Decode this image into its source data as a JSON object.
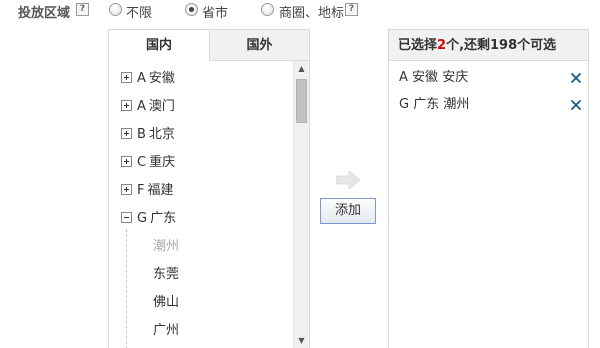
{
  "region": {
    "label": "投放区域",
    "help": "?",
    "options": [
      {
        "label": "不限",
        "checked": false
      },
      {
        "label": "省市",
        "checked": true
      },
      {
        "label": "商圈、地标",
        "checked": false
      }
    ]
  },
  "tabs": [
    "国内",
    "国外"
  ],
  "tree": {
    "provinces": [
      {
        "letter": "A",
        "name": "安徽",
        "expanded": false
      },
      {
        "letter": "A",
        "name": "澳门",
        "expanded": false
      },
      {
        "letter": "B",
        "name": "北京",
        "expanded": false
      },
      {
        "letter": "C",
        "name": "重庆",
        "expanded": false
      },
      {
        "letter": "F",
        "name": "福建",
        "expanded": false
      },
      {
        "letter": "G",
        "name": "广东",
        "expanded": true
      }
    ],
    "children": [
      {
        "name": "潮州",
        "selected": true
      },
      {
        "name": "东莞",
        "selected": false
      },
      {
        "name": "佛山",
        "selected": false
      },
      {
        "name": "广州",
        "selected": false
      }
    ]
  },
  "add_button": "添加",
  "selected_panel": {
    "prefix": "已选择",
    "count": "2",
    "suffix": "个,还剩198个可选",
    "items": [
      {
        "letter": "A",
        "province": "安徽",
        "city": "安庆"
      },
      {
        "letter": "G",
        "province": "广东",
        "city": "潮州"
      }
    ]
  },
  "colors": {
    "accent_count": "#dd0000",
    "remove_icon": "#1a5a8a"
  }
}
